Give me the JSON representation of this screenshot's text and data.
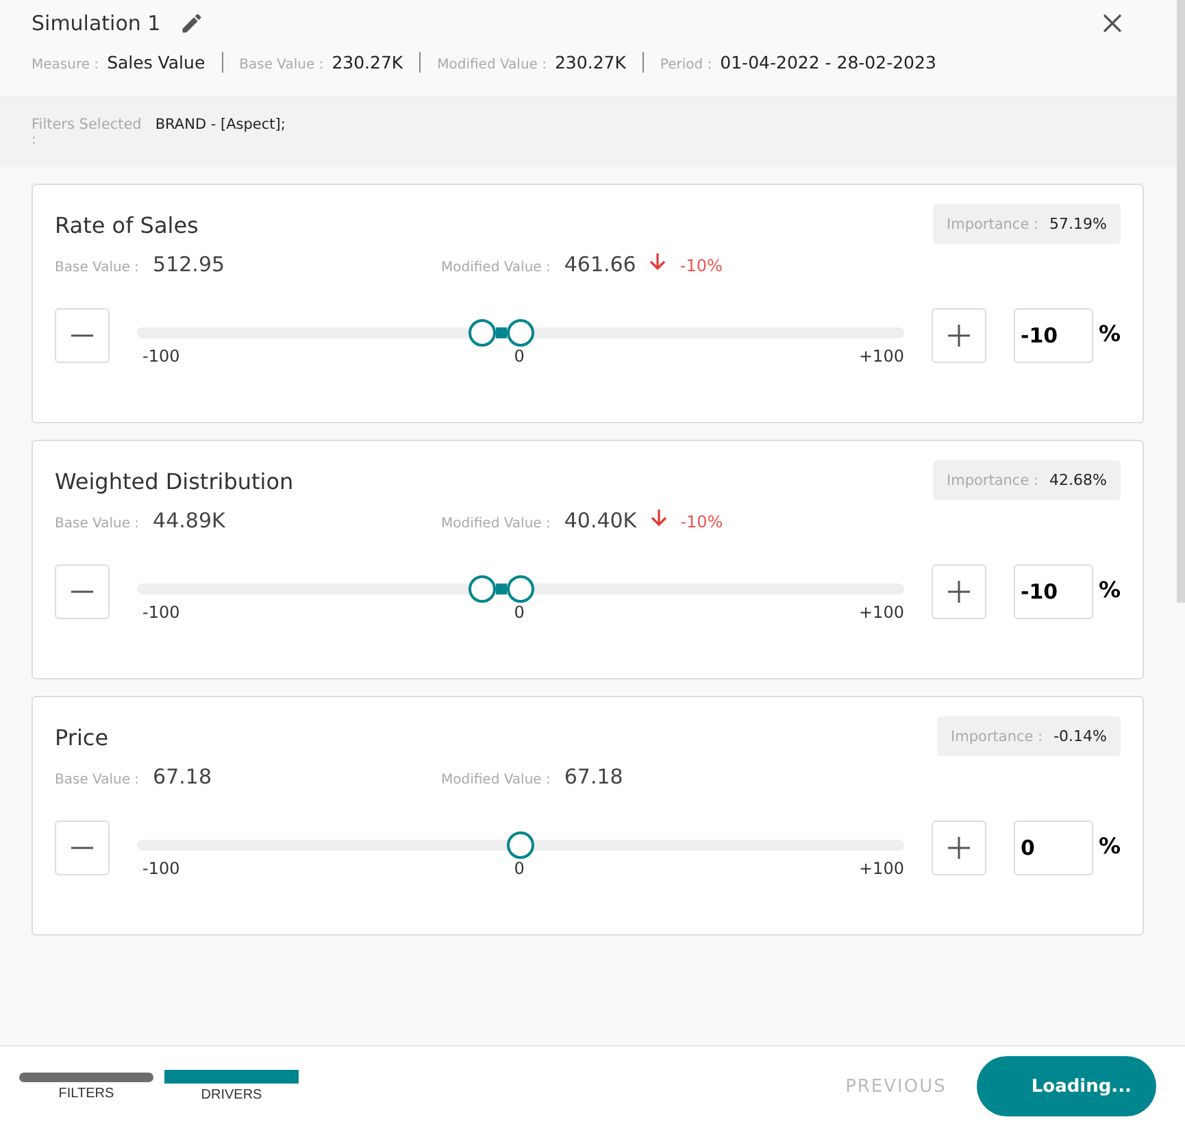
{
  "title": "Simulation 1",
  "meta": [
    {
      "label": "Measure :",
      "value": "Sales Value"
    },
    {
      "label": "Base Value :",
      "value": "230.27K"
    },
    {
      "label": "Modified Value :",
      "value": "230.27K"
    },
    {
      "label": "Period :",
      "value": "01-04-2022 - 28-02-2023"
    }
  ],
  "filters": {
    "label": "Filters Selected",
    "colon": ":",
    "value": "BRAND - [Aspect];"
  },
  "drivers": [
    {
      "name": "Rate of Sales",
      "importance_label": "Importance :",
      "importance": "57.19%",
      "base_label": "Base Value :",
      "base": "512.95",
      "modified_label": "Modified Value :",
      "modified": "461.66",
      "change": "-10%",
      "decreased": true,
      "min": "-100",
      "mid": "0",
      "max": "+100",
      "level": 0.45,
      "input": "-10",
      "unit": "%"
    },
    {
      "name": "Weighted Distribution",
      "importance_label": "Importance :",
      "importance": "42.68%",
      "base_label": "Base Value :",
      "base": "44.89K",
      "modified_label": "Modified Value :",
      "modified": "40.40K",
      "change": "-10%",
      "decreased": true,
      "min": "-100",
      "mid": "0",
      "max": "+100",
      "level": 0.45,
      "input": "-10",
      "unit": "%"
    },
    {
      "name": "Price",
      "importance_label": "Importance :",
      "importance": "-0.14%",
      "base_label": "Base Value :",
      "base": "67.18",
      "modified_label": "Modified Value :",
      "modified": "67.18",
      "decreased": false,
      "min": "-100",
      "mid": "0",
      "max": "+100",
      "level": 0.5,
      "input": "0",
      "unit": "%"
    }
  ],
  "steps": [
    {
      "label": "FILTERS",
      "selected": false
    },
    {
      "label": "DRIVERS",
      "selected": true
    }
  ],
  "previous": "PREVIOUS",
  "next": "Loading..."
}
